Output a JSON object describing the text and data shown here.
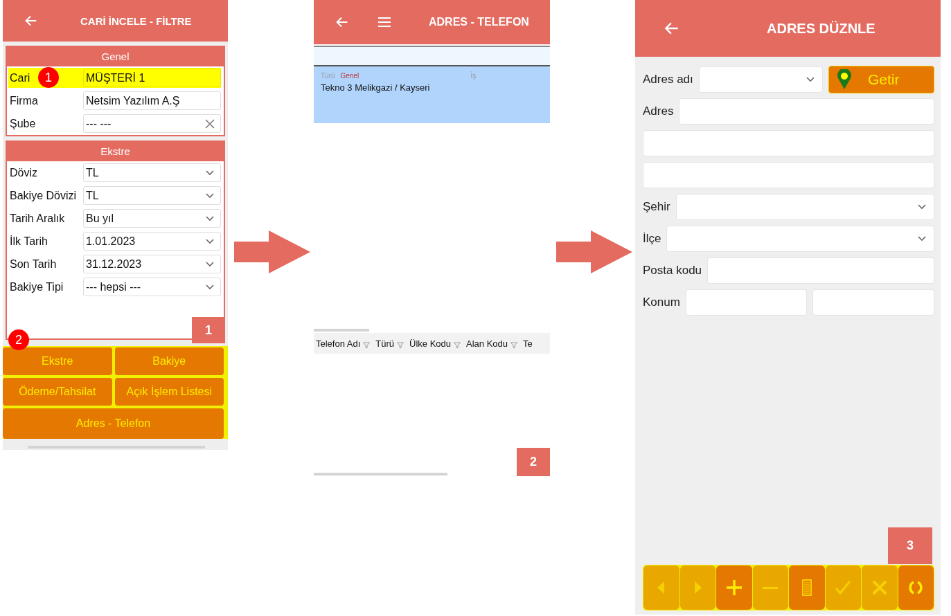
{
  "filter_screen": {
    "title": "CARİ İNCELE - FİLTRE",
    "sections": [
      {
        "title": "Genel",
        "rows": [
          {
            "label": "Cari",
            "value": "MÜŞTERİ 1",
            "kind": "text",
            "highlighted": true
          },
          {
            "label": "Firma",
            "value": "Netsim Yazılım A.Ş",
            "kind": "text",
            "highlighted": false
          },
          {
            "label": "Şube",
            "value": "--- ---",
            "kind": "clearable",
            "highlighted": false
          }
        ]
      },
      {
        "title": "Ekstre",
        "rows": [
          {
            "label": "Döviz",
            "value": "TL",
            "kind": "select",
            "highlighted": false
          },
          {
            "label": "Bakiye Dövizi",
            "value": "TL",
            "kind": "select",
            "highlighted": false
          },
          {
            "label": "Tarih Aralık",
            "value": "Bu yıl",
            "kind": "select",
            "highlighted": false
          },
          {
            "label": "İlk Tarih",
            "value": "1.01.2023",
            "kind": "select",
            "highlighted": false
          },
          {
            "label": "Son Tarih",
            "value": "31.12.2023",
            "kind": "select",
            "highlighted": false
          },
          {
            "label": "Bakiye Tipi",
            "value": "--- hepsi ---",
            "kind": "select",
            "highlighted": false
          }
        ]
      }
    ],
    "callouts": [
      "1",
      "2"
    ],
    "step": "1",
    "buttons": [
      [
        "Ekstre",
        "Bakiye"
      ],
      [
        "Ödeme/Tahsilat",
        "Açık İşlem Listesi"
      ],
      [
        "Adres - Telefon"
      ]
    ]
  },
  "address_list_screen": {
    "title": "ADRES - TELEFON",
    "address_card": {
      "type_label": "Türü",
      "type_value": "Genel",
      "column_3": "İş",
      "text": "Tekno 3 Melikgazi / Kayseri"
    },
    "phone_columns": [
      "Telefon Adı",
      "Türü",
      "Ülke Kodu",
      "Alan Kodu",
      "Te"
    ],
    "step": "2"
  },
  "address_edit_screen": {
    "title": "ADRES DÜZNLE",
    "getir_button": "Getir",
    "fields": [
      {
        "label": "Adres adı",
        "kind": "select"
      },
      {
        "label": "Adres",
        "kind": "text"
      },
      {
        "kind": "text"
      },
      {
        "kind": "text"
      },
      {
        "label": "Şehir",
        "kind": "select"
      },
      {
        "label": "İlçe",
        "kind": "select"
      },
      {
        "label": "Posta kodu",
        "kind": "text"
      },
      {
        "label": "Konum",
        "kind": "pair"
      }
    ],
    "step": "3",
    "toolbar": [
      {
        "kind": "prev",
        "disabled": true
      },
      {
        "kind": "next",
        "disabled": true
      },
      {
        "kind": "add",
        "disabled": false
      },
      {
        "kind": "remove",
        "disabled": true
      },
      {
        "kind": "list",
        "disabled": false
      },
      {
        "kind": "confirm",
        "disabled": true
      },
      {
        "kind": "cancel",
        "disabled": true
      },
      {
        "kind": "refresh",
        "disabled": false
      }
    ]
  }
}
